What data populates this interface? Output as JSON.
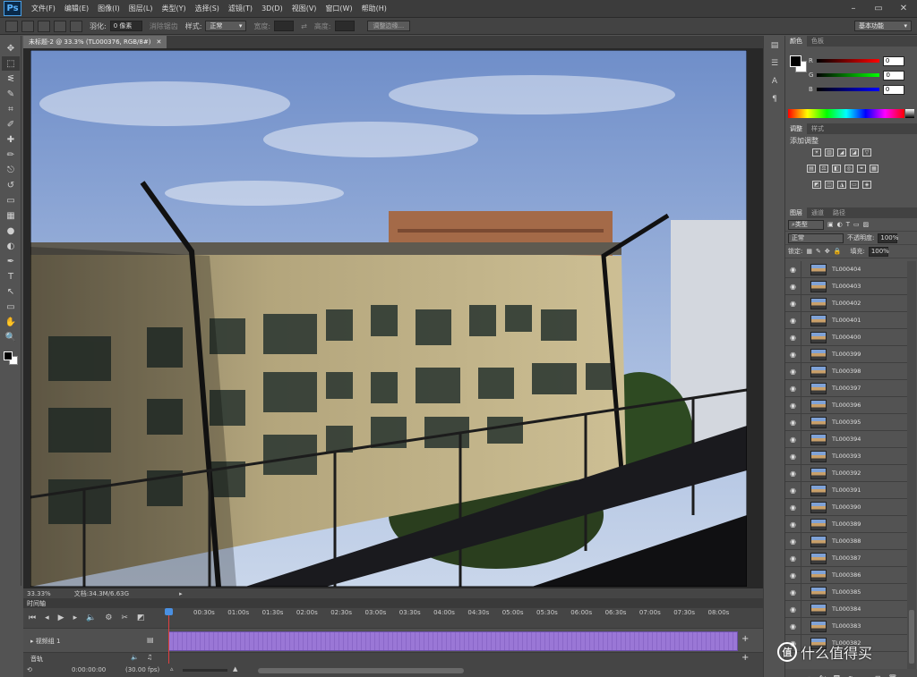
{
  "app": {
    "logo": "Ps",
    "menus": [
      "文件(F)",
      "编辑(E)",
      "图像(I)",
      "图层(L)",
      "类型(Y)",
      "选择(S)",
      "滤镜(T)",
      "3D(D)",
      "视图(V)",
      "窗口(W)",
      "帮助(H)"
    ],
    "window_buttons": [
      "–",
      "▭",
      "✕"
    ]
  },
  "options_bar": {
    "feather_label": "羽化:",
    "feather_value": "0 像素",
    "antialias_label": "消除锯齿",
    "style_label": "样式:",
    "style_value": "正常",
    "width_label": "宽度:",
    "height_label": "高度:",
    "refine_edge_button": "调整边缘...",
    "workspace": "基本功能"
  },
  "tools": [
    "move-tool",
    "marquee-tool",
    "lasso-tool",
    "quick-select-tool",
    "crop-tool",
    "eyedropper-tool",
    "healing-tool",
    "brush-tool",
    "clone-stamp-tool",
    "history-brush-tool",
    "eraser-tool",
    "gradient-tool",
    "blur-tool",
    "dodge-tool",
    "pen-tool",
    "type-tool",
    "path-select-tool",
    "shape-tool",
    "hand-tool",
    "zoom-tool"
  ],
  "tool_glyphs": [
    "✥",
    "⬚",
    "ᓬ",
    "✎",
    "⌗",
    "✐",
    "✚",
    "✏",
    "⎋",
    "↺",
    "▭",
    "▦",
    "●",
    "◐",
    "✒",
    "T",
    "↖",
    "▭",
    "✋",
    "🔍"
  ],
  "document": {
    "tab_title": "未标题-2 @ 33.3% (TL000376, RGB/8#)",
    "tab_close": "✕",
    "zoom": "33.33%",
    "doc_info": "文档:34.3M/6.63G",
    "photo_alt": "photo"
  },
  "timeline": {
    "panel_title": "时间轴",
    "ticks": [
      "00:30s",
      "01:00s",
      "01:30s",
      "02:00s",
      "02:30s",
      "03:00s",
      "03:30s",
      "04:00s",
      "04:30s",
      "05:00s",
      "05:30s",
      "06:00s",
      "06:30s",
      "07:00s",
      "07:30s",
      "08:00s"
    ],
    "video_group": "视频组 1",
    "audio_track": "音轨",
    "timecode": "0:00:00:00",
    "fps": "(30.00 fps)"
  },
  "color_panel": {
    "tabs": [
      "颜色",
      "色板"
    ],
    "r_label": "R",
    "g_label": "G",
    "b_label": "B",
    "r_value": "0",
    "g_value": "0",
    "b_value": "0"
  },
  "adjustments_panel": {
    "tabs": [
      "调整",
      "样式"
    ],
    "title": "添加调整"
  },
  "layers_panel": {
    "tabs": [
      "图层",
      "通道",
      "路径"
    ],
    "filter_kind": "类型",
    "blend_mode": "正常",
    "opacity_label": "不透明度:",
    "opacity_value": "100%",
    "lock_label": "锁定:",
    "fill_label": "填充:",
    "fill_value": "100%",
    "layers": [
      "TL000404",
      "TL000403",
      "TL000402",
      "TL000401",
      "TL000400",
      "TL000399",
      "TL000398",
      "TL000397",
      "TL000396",
      "TL000395",
      "TL000394",
      "TL000393",
      "TL000392",
      "TL000391",
      "TL000390",
      "TL000389",
      "TL000388",
      "TL000387",
      "TL000386",
      "TL000385",
      "TL000384",
      "TL000383",
      "TL000382"
    ]
  },
  "watermark": {
    "logo_text": "值",
    "text": "什么值得买"
  }
}
